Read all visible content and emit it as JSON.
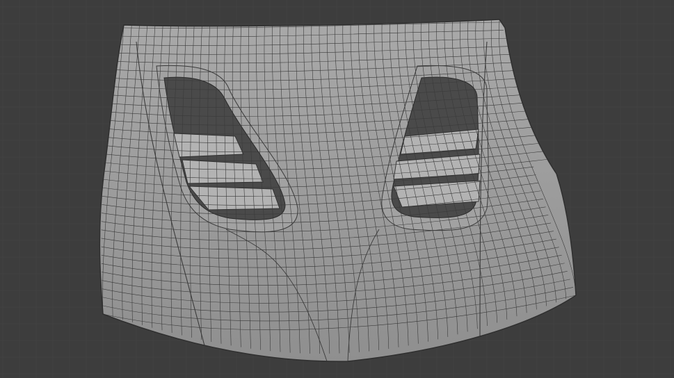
{
  "viewport": {
    "background": "#3d3d3d",
    "grid_line_color": "#464646",
    "grid_dot_color": "#4f4f4f"
  },
  "model": {
    "object": "car-hood-wireframe",
    "surface_color": "#9d9d9d",
    "surface_shade_top": "#a9a9a9",
    "surface_shade_bottom": "#8f8f8f",
    "edge_color": "#3a3a3a",
    "vent_shadow_color": "#4a4a4a",
    "vent_slat_color": "#b3b3b3"
  }
}
